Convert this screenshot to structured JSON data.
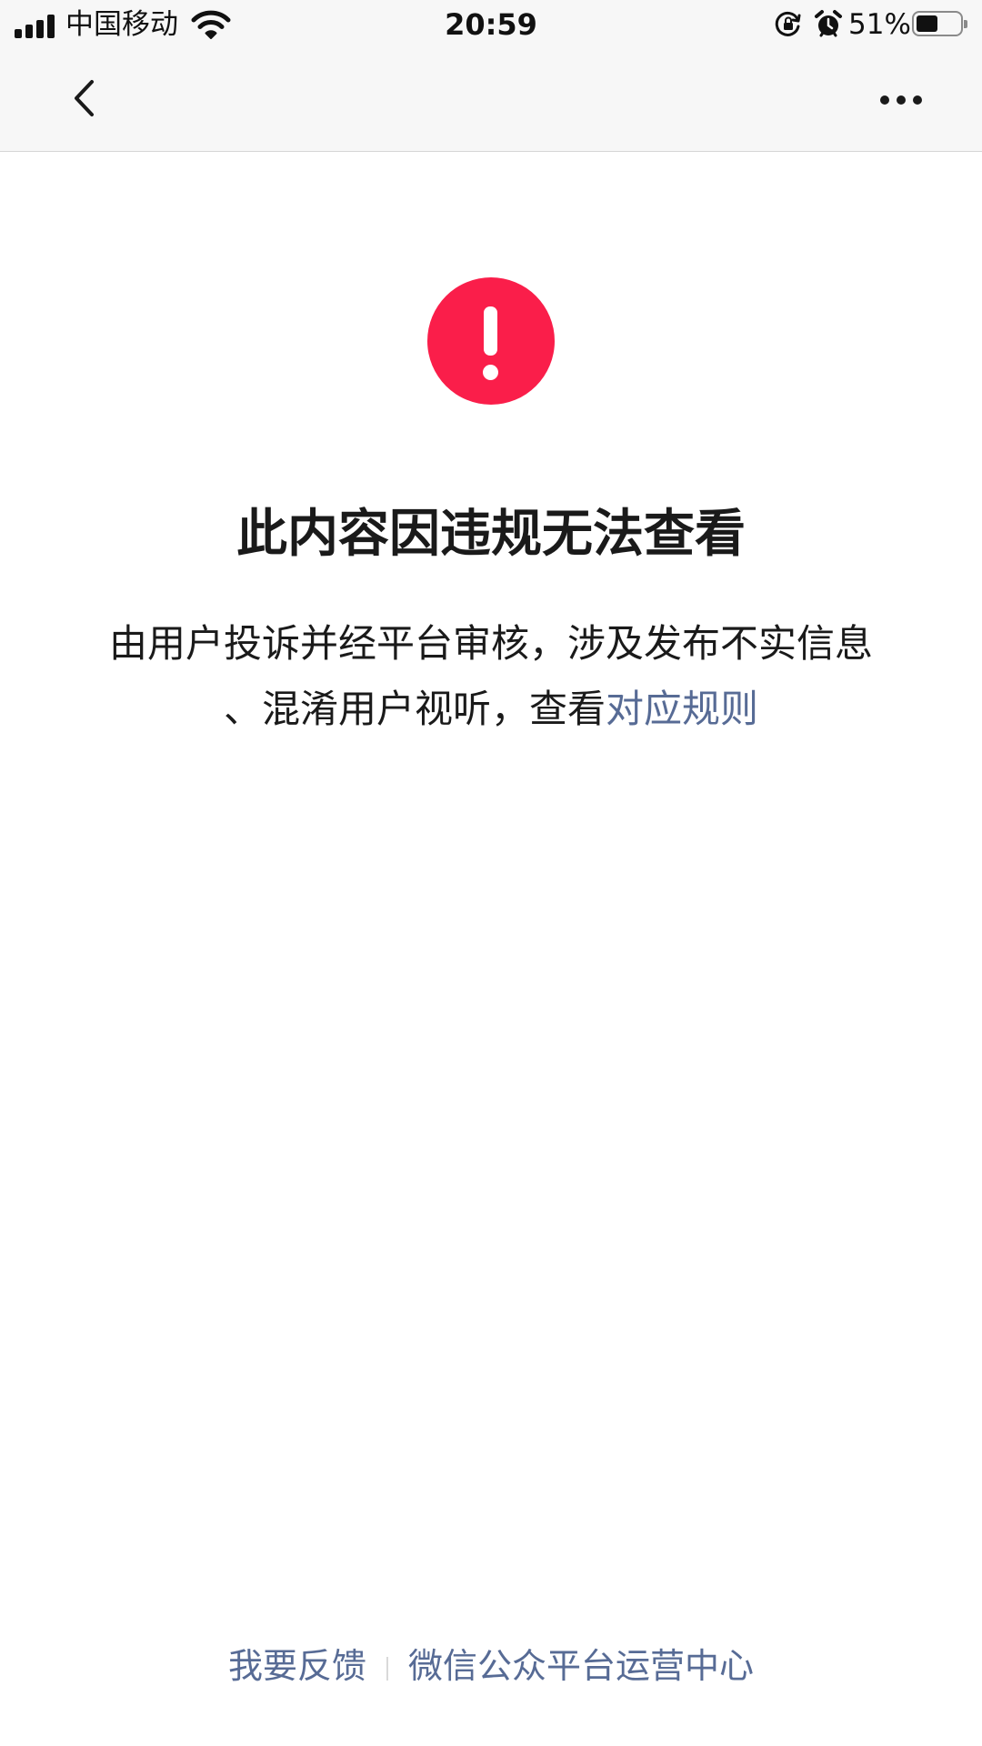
{
  "status_bar": {
    "carrier": "中国移动",
    "time": "20:59",
    "battery_percent": "51%",
    "battery_level": 0.51,
    "signal_bars": 4,
    "icons": [
      "signal-icon",
      "wifi-icon",
      "orientation-lock-icon",
      "alarm-icon",
      "battery-icon"
    ]
  },
  "nav": {
    "back_icon": "chevron-left-icon",
    "more_icon": "more-dots-icon"
  },
  "content": {
    "icon": "exclamation-icon",
    "icon_color": "#fa1e4a",
    "title": "此内容因违规无法查看",
    "description_line1": "由用户投诉并经平台审核，涉及发布不实信息",
    "description_line2": "、混淆用户视听，查看",
    "rules_link": "对应规则",
    "link_color": "#576b95"
  },
  "footer": {
    "feedback_link": "我要反馈",
    "ops_center_link": "微信公众平台运营中心"
  }
}
